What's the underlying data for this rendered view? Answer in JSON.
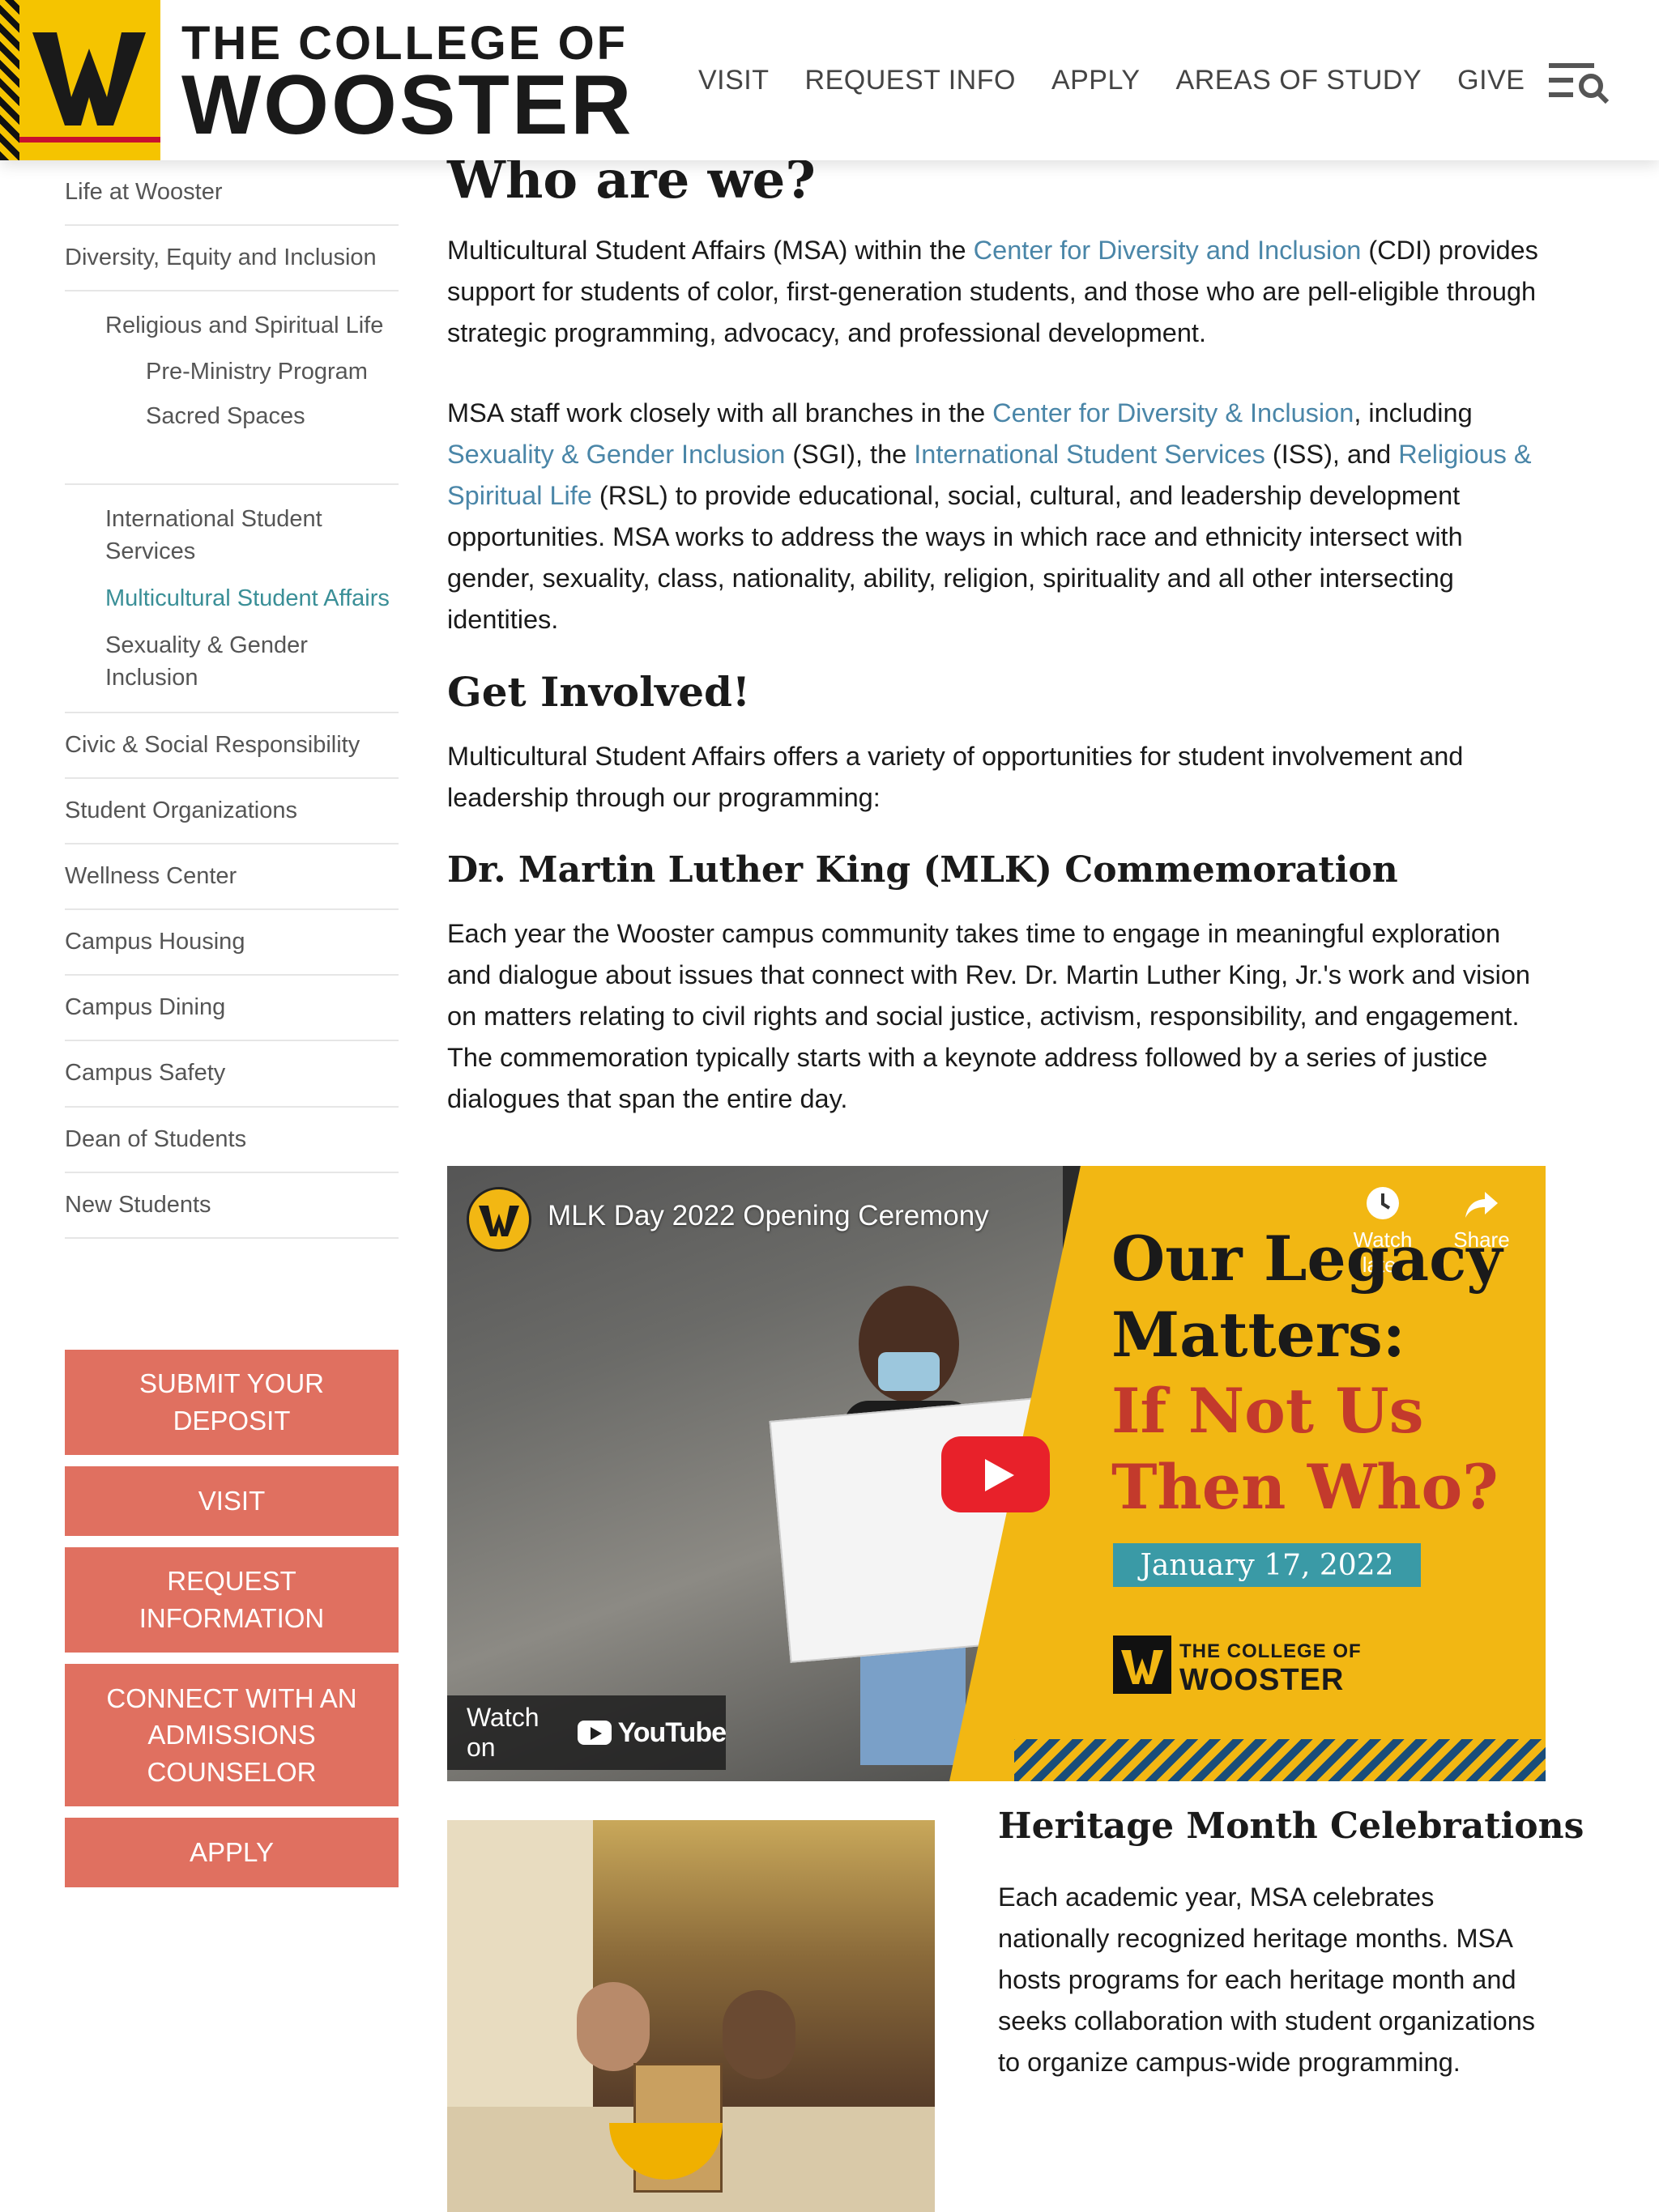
{
  "header": {
    "logo_line1": "THE COLLEGE OF",
    "logo_line2": "WOOSTER",
    "nav": [
      "VISIT",
      "REQUEST INFO",
      "APPLY",
      "AREAS OF STUDY",
      "GIVE"
    ],
    "menu_icon": "menu-search-icon",
    "colors": {
      "brand_yellow": "#f5c400",
      "brand_red": "#c8102e",
      "text": "#1a1a1a"
    }
  },
  "sidebar": {
    "items_top": [
      "Life at Wooster",
      "Diversity, Equity and Inclusion"
    ],
    "sub_items": [
      {
        "label": "Religious and Spiritual Life",
        "children": [
          "Pre-Ministry Program",
          "Sacred Spaces"
        ]
      }
    ],
    "sub_items_2": [
      "International Student Services",
      "Multicultural Student Affairs",
      "Sexuality & Gender Inclusion"
    ],
    "active_item": "Multicultural Student Affairs",
    "items_bottom": [
      "Civic & Social Responsibility",
      "Student Organizations",
      "Wellness Center",
      "Campus Housing",
      "Campus Dining",
      "Campus Safety",
      "Dean of Students",
      "New Students"
    ],
    "cta_buttons": [
      "SUBMIT YOUR DEPOSIT",
      "VISIT",
      "REQUEST INFORMATION",
      "CONNECT WITH AN ADMISSIONS COUNSELOR",
      "APPLY"
    ],
    "colors": {
      "active": "#3a8f97",
      "cta_bg": "#e07060"
    }
  },
  "main": {
    "who_title": "Who are we?",
    "who_p1": {
      "t1": "Multicultural Student Affairs (MSA) within the ",
      "link1": "Center for Diversity and Inclusion",
      "t2": " (CDI) provides support for students of color, first-generation students, and those who are pell-eligible through strategic programming, advocacy, and professional development."
    },
    "who_p2": {
      "t1": "MSA staff work closely with all branches in the ",
      "link1": "Center for Diversity & Inclusion",
      "t2": ", including ",
      "link2": "Sexuality & Gender Inclusion",
      "t3": " (SGI), the ",
      "link3": "International Student Services",
      "t4": " (ISS), and ",
      "link4": "Religious & Spiritual Life",
      "t5": " (RSL) to provide educational, social, cultural, and leadership development opportunities. MSA works to address the ways in which race and ethnicity intersect with gender, sexuality, class, nationality, ability, religion, spirituality and all other intersecting identities."
    },
    "involved_title": "Get Involved!",
    "involved_p": "Multicultural Student Affairs offers a variety of opportunities for student involvement and leadership through our programming:",
    "mlk_title": "Dr. Martin Luther King (MLK) Commemoration",
    "mlk_p": "Each year the Wooster campus community takes time to engage in meaningful exploration and dialogue about issues that connect with Rev. Dr. Martin Luther King, Jr.'s work and vision on matters relating to civil rights and social justice, activism, responsibility, and engagement. The commemoration typically starts with a keynote address followed by a series of justice dialogues that span the entire day.",
    "link_color": "#4a86a8"
  },
  "video": {
    "title": "MLK Day 2022 Opening Ceremony",
    "watch_later": "Watch later",
    "share": "Share",
    "headline1": "Our Legacy",
    "headline2": "Matters:",
    "headline3": "If Not Us",
    "headline4": "Then Who?",
    "date": "January 17, 2022",
    "logo_line1": "THE COLLEGE OF",
    "logo_line2": "WOOSTER",
    "watch_on": "Watch on",
    "youtube": "YouTube"
  },
  "heritage": {
    "title": "Heritage Month Celebrations",
    "text": "Each academic year, MSA celebrates nationally recognized heritage months. MSA hosts programs for each heritage month and seeks collaboration with student organizations to organize campus-wide programming."
  }
}
